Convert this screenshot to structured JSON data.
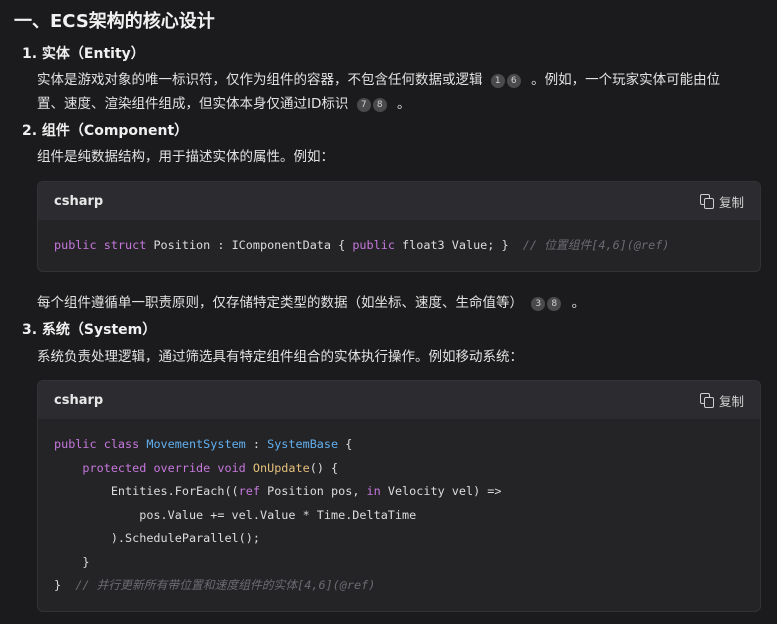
{
  "heading": "一、ECS架构的核心设计",
  "items": [
    {
      "title": "1. 实体（Entity）",
      "para1_text": "实体是游戏对象的唯一标识符，仅作为组件的容器，不包含任何数据或逻辑",
      "para1_cites": [
        "1",
        "6"
      ],
      "para1_after": "。例如，一个玩家实体可能由位",
      "para2_text": "置、速度、渲染组件组成，但实体本身仅通过ID标识",
      "para2_cites": [
        "7",
        "8"
      ],
      "para2_after": "。"
    },
    {
      "title": "2. 组件（Component）",
      "para1_text": "组件是纯数据结构，用于描述实体的属性。例如：",
      "after_code_text": "每个组件遵循单一职责原则，仅存储特定类型的数据（如坐标、速度、生命值等）",
      "after_code_cites": [
        "3",
        "8"
      ],
      "after_code_after": "。"
    },
    {
      "title": "3. 系统（System）",
      "para1_text": "系统负责处理逻辑，通过筛选具有特定组件组合的实体执行操作。例如移动系统："
    }
  ],
  "code_blocks": [
    {
      "lang": "csharp",
      "copy_label": "复制",
      "lines": [
        "public struct Position : IComponentData { public float3 Value; }  // 位置组件[4,6](@ref)"
      ]
    },
    {
      "lang": "csharp",
      "copy_label": "复制",
      "lines": [
        "public class MovementSystem : SystemBase {",
        "    protected override void OnUpdate() {",
        "        Entities.ForEach((ref Position pos, in Velocity vel) =>",
        "            pos.Value += vel.Value * Time.DeltaTime",
        "        ).ScheduleParallel();",
        "    }",
        "}  // 并行更新所有带位置和速度组件的实体[4,6](@ref)"
      ]
    }
  ],
  "icons": {
    "copy": "copy-icon"
  },
  "colors": {
    "keyword": "#c678dd",
    "type": "#61afef",
    "function": "#e5c07b",
    "comment": "#6b6b73"
  }
}
